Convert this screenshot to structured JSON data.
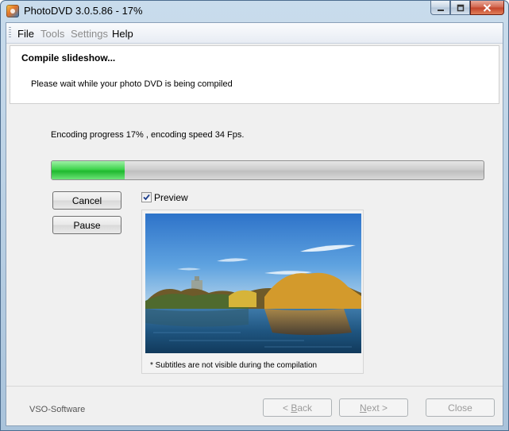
{
  "window": {
    "title": "PhotoDVD 3.0.5.86 - 17%",
    "icon": "photodvd-app-icon",
    "minimize_icon": "minimize-icon",
    "maximize_icon": "maximize-icon",
    "close_icon": "close-icon"
  },
  "menu": {
    "items": [
      {
        "label": "File",
        "enabled": true
      },
      {
        "label": "Tools",
        "enabled": false
      },
      {
        "label": "Settings",
        "enabled": false
      },
      {
        "label": "Help",
        "enabled": true
      }
    ]
  },
  "header": {
    "title": "Compile slideshow...",
    "subtitle": "Please wait while your photo DVD is being compiled"
  },
  "progress": {
    "text": "Encoding progress 17% , encoding speed 34 Fps.",
    "percent": 17,
    "color": "#3fd44d"
  },
  "buttons": {
    "cancel": "Cancel",
    "pause": "Pause"
  },
  "preview": {
    "checkbox_label": "Preview",
    "checked": true,
    "note": "* Subtitles are not visible during the compilation"
  },
  "footer": {
    "brand": "VSO-Software",
    "back_prefix": "< ",
    "back_mnemonic": "B",
    "back_rest": "ack",
    "next_mnemonic": "N",
    "next_rest": "ext >",
    "close": "Close"
  }
}
